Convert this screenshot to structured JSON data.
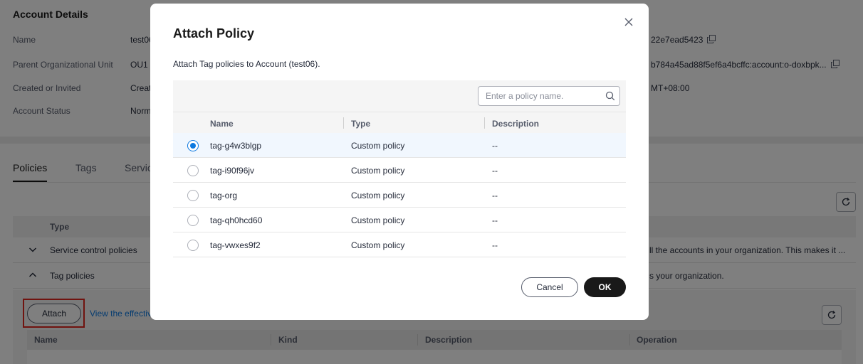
{
  "account_details": {
    "title": "Account Details",
    "rows": [
      {
        "label": "Name",
        "value": "test06",
        "right": "22e7ead5423"
      },
      {
        "label": "Parent Organizational Unit",
        "value": "OU1",
        "right": "b784a45ad88f5ef6a4bcffc:account:o-doxbpk..."
      },
      {
        "label": "Created or Invited",
        "value": "Creat",
        "right": "MT+08:00"
      },
      {
        "label": "Account Status",
        "value": "Norm",
        "right": ""
      }
    ]
  },
  "tabs": [
    "Policies",
    "Tags",
    "Servic"
  ],
  "policy_types": {
    "header": "Type",
    "rows": [
      {
        "label": "Service control policies",
        "desc": "ll the accounts in your organization. This makes it ...",
        "expanded": false
      },
      {
        "label": "Tag policies",
        "desc": "s your organization.",
        "expanded": true
      }
    ]
  },
  "tag_section": {
    "attach_label": "Attach",
    "view_link": "View the effectiv",
    "columns": [
      "Name",
      "Kind",
      "Description",
      "Operation"
    ]
  },
  "modal": {
    "title": "Attach Policy",
    "subtitle": "Attach Tag policies to Account (test06).",
    "search_placeholder": "Enter a policy name.",
    "columns": [
      "Name",
      "Type",
      "Description"
    ],
    "rows": [
      {
        "name": "tag-g4w3blgp",
        "type": "Custom policy",
        "desc": "--",
        "selected": true
      },
      {
        "name": "tag-i90f96jv",
        "type": "Custom policy",
        "desc": "--",
        "selected": false
      },
      {
        "name": "tag-org",
        "type": "Custom policy",
        "desc": "--",
        "selected": false
      },
      {
        "name": "tag-qh0hcd60",
        "type": "Custom policy",
        "desc": "--",
        "selected": false
      },
      {
        "name": "tag-vwxes9f2",
        "type": "Custom policy",
        "desc": "--",
        "selected": false
      }
    ],
    "cancel_label": "Cancel",
    "ok_label": "OK"
  },
  "colors": {
    "accent": "#0d79e0",
    "primary_button": "#191919",
    "highlight_box": "#e0271f",
    "selected_row": "#f1f7fe"
  }
}
